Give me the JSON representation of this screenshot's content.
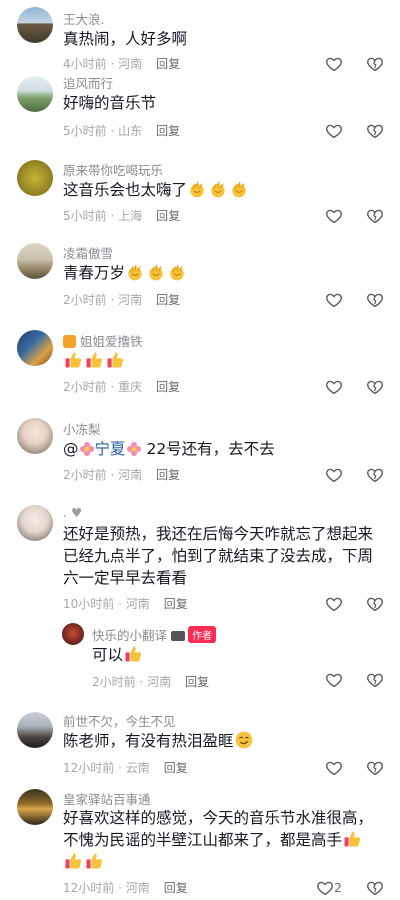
{
  "reply_label": "回复",
  "author_badge": "作者",
  "comments": [
    {
      "author": "王大浪.",
      "text": "真热闹，人好多啊",
      "time": "4小时前",
      "location": "河南"
    },
    {
      "author": "追风而行",
      "text": "好嗨的音乐节",
      "time": "5小时前",
      "location": "山东"
    },
    {
      "author": "原来带你吃喝玩乐",
      "text": "这音乐会也太嗨了",
      "time": "5小时前",
      "location": "上海",
      "emojis": [
        "clap-emoji",
        "clap-emoji",
        "clap-emoji"
      ]
    },
    {
      "author": "凌霜傲雪",
      "text": "青春万岁",
      "time": "2小时前",
      "location": "河南",
      "emojis": [
        "clap-emoji",
        "clap-emoji",
        "clap-emoji"
      ]
    },
    {
      "author": "姐姐爱撸铁",
      "text": "",
      "time": "2小时前",
      "location": "重庆",
      "emojis": [
        "thumbs-up-emoji",
        "thumbs-up-emoji",
        "thumbs-up-emoji"
      ]
    },
    {
      "author": "小冻梨",
      "mention": "宁夏",
      "text": "22号还有，去不去",
      "time": "2小时前",
      "location": "河南"
    },
    {
      "author": ".",
      "text_lines": [
        "还好是预热，我还在后悔今天咋就忘了想起来",
        "已经九点半了，怕到了就结束了没去成，下周",
        "六一定早早去看看"
      ],
      "time": "10小时前",
      "location": "河南"
    },
    {
      "author": "快乐的小翻译",
      "text": "可以",
      "time": "2小时前",
      "location": "河南",
      "emojis": [
        "thumbs-up-emoji"
      ]
    },
    {
      "author": "前世不欠，今生不见",
      "text": "陈老师，有没有热泪盈眶",
      "time": "12小时前",
      "location": "云南",
      "emojis": [
        "smirk-emoji"
      ]
    },
    {
      "author": "皇家驿站百事通",
      "text_lines": [
        "好喜欢这样的感觉，今天的音乐节水准很高，",
        "不愧为民谣的半壁江山都来了，都是高手"
      ],
      "time": "12小时前",
      "location": "河南",
      "like_count": "2"
    }
  ],
  "colors": {
    "author": "#8a8b91",
    "meta": "#a6a7ac",
    "mention": "#2b5d9e",
    "badge": "#fe2c55"
  }
}
